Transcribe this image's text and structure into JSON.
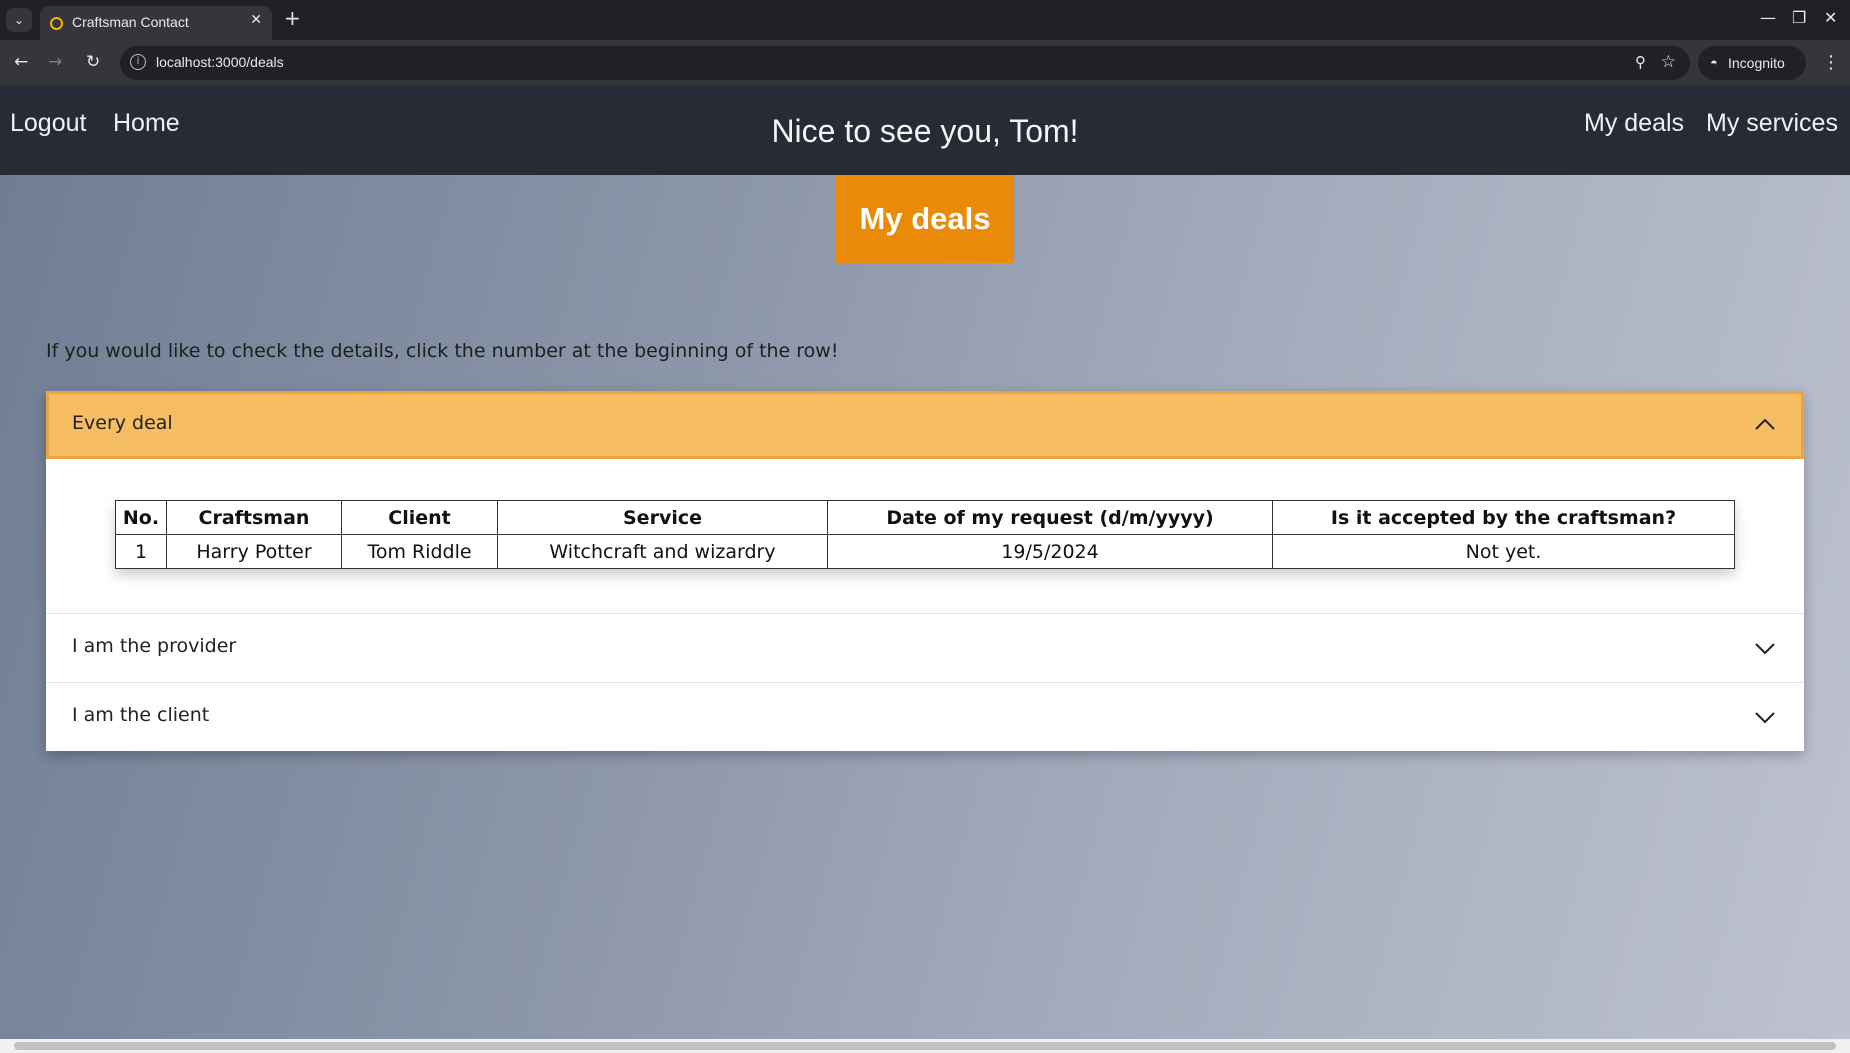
{
  "browser": {
    "tab_title": "Craftsman Contact",
    "url": "localhost:3000/deals",
    "incognito_label": "Incognito"
  },
  "nav": {
    "logout": "Logout",
    "home": "Home",
    "greeting": "Nice to see you, Tom!",
    "my_deals": "My deals",
    "my_services": "My services"
  },
  "banner": {
    "title": "My deals"
  },
  "hint": "If you would like to check the details, click the number at the beginning of the row!",
  "accordion": {
    "sections": [
      {
        "title": "Every deal",
        "expanded": true
      },
      {
        "title": "I am the provider",
        "expanded": false
      },
      {
        "title": "I am the client",
        "expanded": false
      }
    ]
  },
  "deals_table": {
    "headers": [
      "No.",
      "Craftsman",
      "Client",
      "Service",
      "Date of my request (d/m/yyyy)",
      "Is it accepted by the craftsman?"
    ],
    "rows": [
      [
        "1",
        "Harry Potter",
        "Tom Riddle",
        "Witchcraft and wizardry",
        "19/5/2024",
        "Not yet."
      ]
    ]
  },
  "colors": {
    "nav_bg": "#272b36",
    "banner_bg": "#e98a08",
    "accordion_open_bg": "#f7bd63"
  },
  "icons": {
    "expand": "chevron-down-icon",
    "collapse": "chevron-up-icon"
  }
}
